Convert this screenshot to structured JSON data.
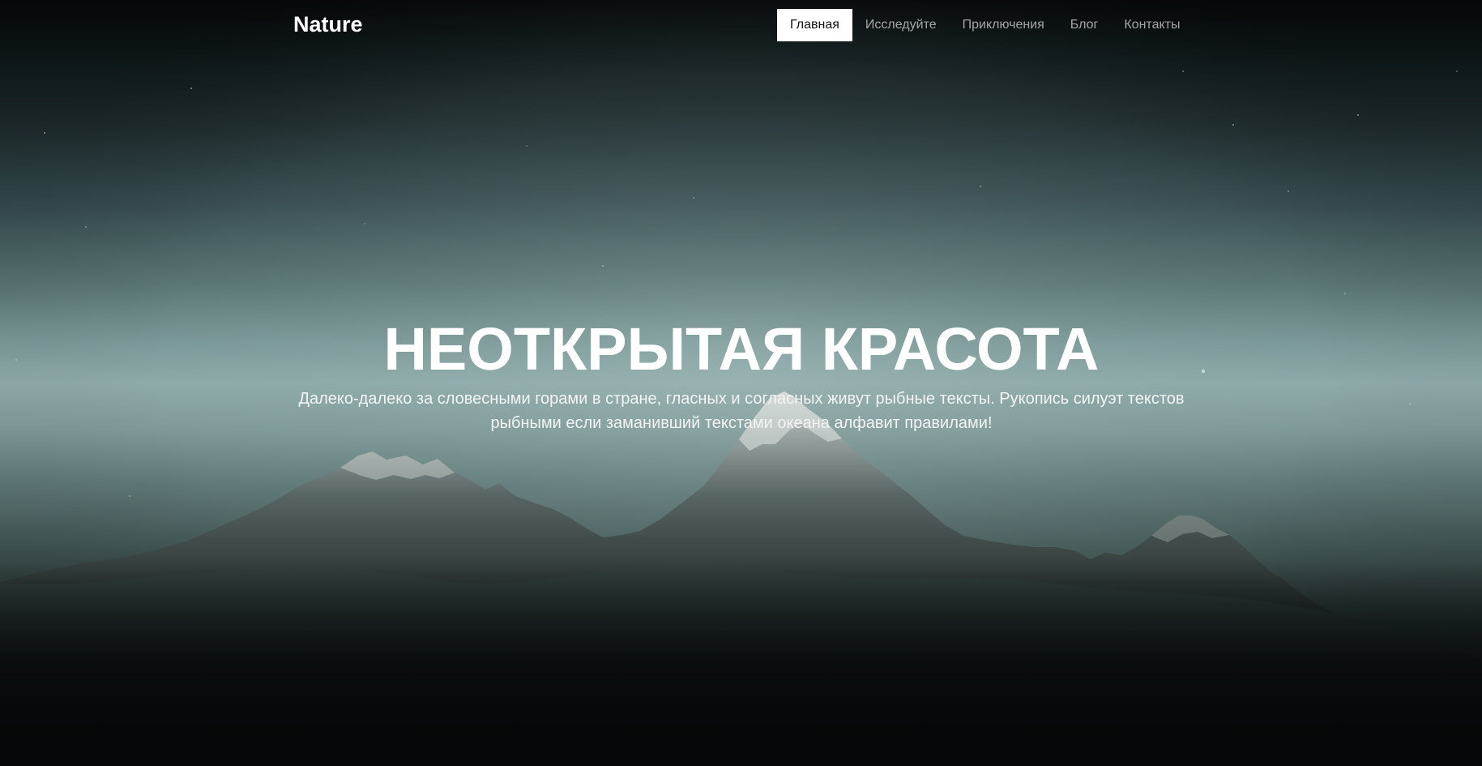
{
  "brand": {
    "name": "Nature"
  },
  "nav": {
    "items": [
      {
        "label": "Главная",
        "active": true
      },
      {
        "label": "Исследуйте",
        "active": false
      },
      {
        "label": "Приключения",
        "active": false
      },
      {
        "label": "Блог",
        "active": false
      },
      {
        "label": "Контакты",
        "active": false
      }
    ]
  },
  "hero": {
    "title": "НЕОТКРЫТАЯ КРАСОТА",
    "text": "Далеко-далеко за словесными горами в стране, гласных и согласных живут рыбные тексты. Рукопись силуэт текстов рыбными если заманивший текстами океана алфавит правилами!"
  },
  "colors": {
    "accent": "#ffffff",
    "nav_text": "#9fa3a4",
    "active_nav_text": "#111111"
  },
  "background": {
    "subject": "night sky above snowy mountains"
  }
}
